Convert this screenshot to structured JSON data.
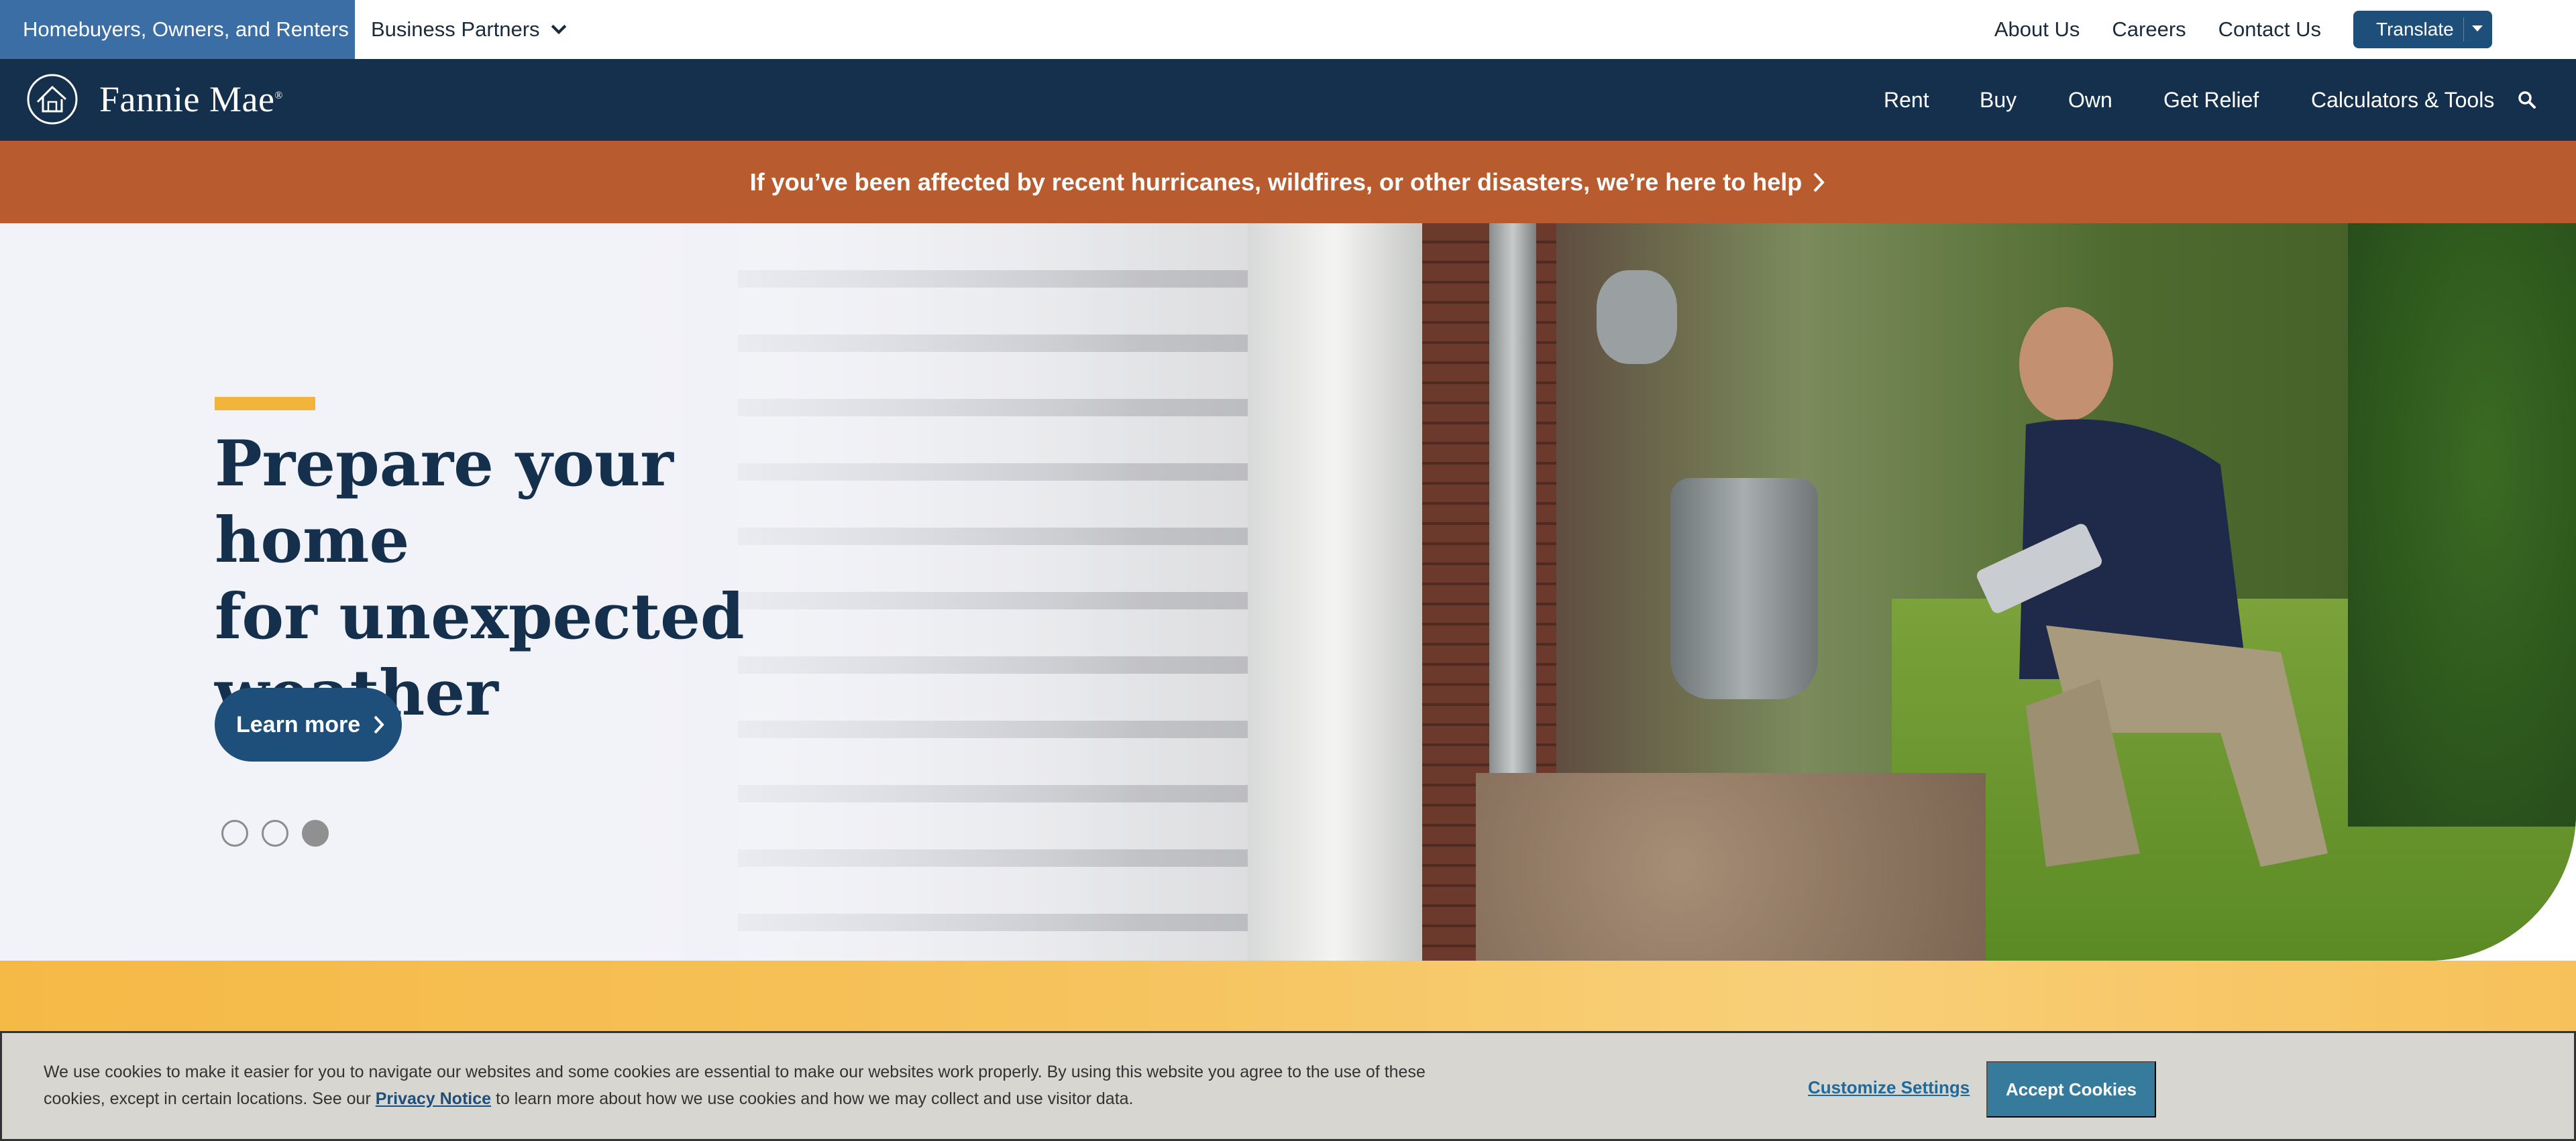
{
  "utility_bar": {
    "audience_active": "Homebuyers, Owners, and Renters",
    "audience_other": "Business Partners",
    "links": [
      "About Us",
      "Careers",
      "Contact Us"
    ],
    "translate_label": "Translate"
  },
  "header": {
    "brand_name": "Fannie Mae",
    "brand_mark": "®",
    "nav": [
      "Rent",
      "Buy",
      "Own",
      "Get Relief",
      "Calculators & Tools"
    ],
    "search_icon": "search-icon"
  },
  "alert": {
    "text": "If you’ve been affected by recent hurricanes, wildfires, or other disasters, we’re here to help"
  },
  "hero": {
    "title_line1": "Prepare your home",
    "title_line2": "for unexpected",
    "title_line3": "weather",
    "cta_label": "Learn more",
    "carousel_total": 3,
    "carousel_active": 3
  },
  "cookie_banner": {
    "text_before": "We use cookies to make it easier for you to navigate our websites and some cookies are essential to make our websites work properly. By using this website you agree to the use of these cookies, except in certain locations. See our ",
    "privacy_link": "Privacy Notice",
    "text_after": " to learn more about how we use cookies and how we may collect and use visitor data.",
    "customize_label": "Customize Settings",
    "accept_label": "Accept Cookies"
  },
  "colors": {
    "navy": "#14304d",
    "accent_blue": "#1d4f7a",
    "alert_orange": "#b85b2f",
    "accent_yellow": "#f2b43a"
  }
}
